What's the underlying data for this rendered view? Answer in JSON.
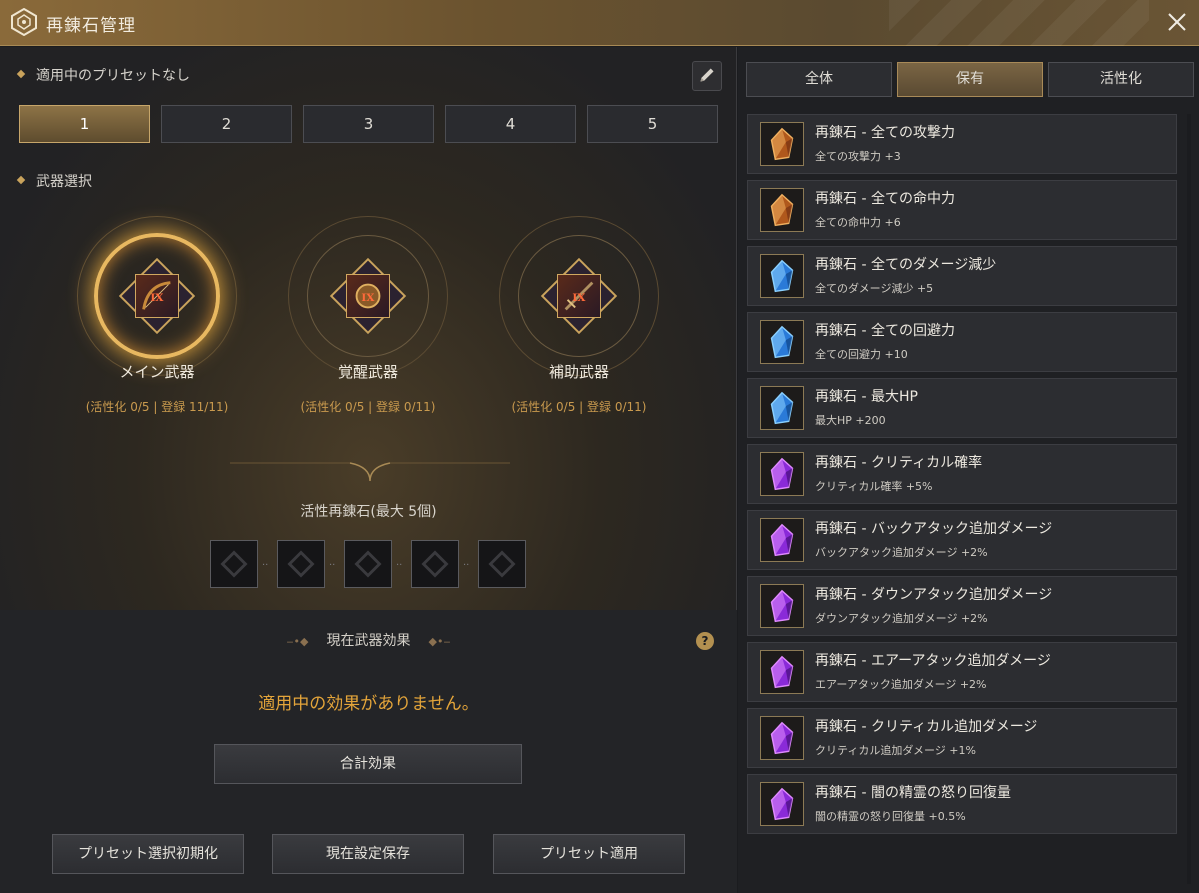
{
  "window": {
    "title": "再錬石管理",
    "logo_icon": "hexagon-logo-icon",
    "close_icon": "close-icon"
  },
  "preset": {
    "status_label": "適用中のプリセットなし",
    "tabs": [
      "1",
      "2",
      "3",
      "4",
      "5"
    ],
    "active_tab": "1"
  },
  "weapon_select": {
    "label": "武器選択",
    "weapons": [
      {
        "name": "メイン武器",
        "stat": "(活性化 0/5 | 登録 11/11)",
        "icon": "bow-icon",
        "grade": "IX",
        "selected": true
      },
      {
        "name": "覚醒武器",
        "stat": "(活性化 0/5 | 登録 0/11)",
        "icon": "orb-icon",
        "grade": "IX",
        "selected": false
      },
      {
        "name": "補助武器",
        "stat": "(活性化 0/5 | 登録 0/11)",
        "icon": "dagger-icon",
        "grade": "IX",
        "selected": false
      }
    ]
  },
  "active_stones": {
    "title": "活性再錬石(最大 5個)"
  },
  "effects": {
    "header": "現在武器効果",
    "empty_message": "適用中の効果がありません。",
    "total_button": "合計効果"
  },
  "footer": {
    "reset_button": "プリセット選択初期化",
    "save_button": "現在設定保存",
    "apply_button": "プリセット適用"
  },
  "filters": {
    "tabs": [
      "全体",
      "保有",
      "活性化"
    ],
    "active_tab": "保有"
  },
  "stones": [
    {
      "name": "再錬石 - 全ての攻撃力",
      "desc": "全ての攻撃力 +3",
      "gem": "orange"
    },
    {
      "name": "再錬石 - 全ての命中力",
      "desc": "全ての命中力 +6",
      "gem": "orange"
    },
    {
      "name": "再錬石 - 全てのダメージ減少",
      "desc": "全てのダメージ減少 +5",
      "gem": "blue"
    },
    {
      "name": "再錬石 - 全ての回避力",
      "desc": "全ての回避力 +10",
      "gem": "blue"
    },
    {
      "name": "再錬石 - 最大HP",
      "desc": "最大HP +200",
      "gem": "blue"
    },
    {
      "name": "再錬石 - クリティカル確率",
      "desc": "クリティカル確率 +5%",
      "gem": "purple"
    },
    {
      "name": "再錬石 - バックアタック追加ダメージ",
      "desc": "バックアタック追加ダメージ +2%",
      "gem": "purple"
    },
    {
      "name": "再錬石 - ダウンアタック追加ダメージ",
      "desc": "ダウンアタック追加ダメージ +2%",
      "gem": "purple"
    },
    {
      "name": "再錬石 - エアーアタック追加ダメージ",
      "desc": "エアーアタック追加ダメージ +2%",
      "gem": "purple"
    },
    {
      "name": "再錬石 - クリティカル追加ダメージ",
      "desc": "クリティカル追加ダメージ +1%",
      "gem": "purple"
    },
    {
      "name": "再錬石 - 闇の精霊の怒り回復量",
      "desc": "闇の精霊の怒り回復量 +0.5%",
      "gem": "purple"
    }
  ],
  "colors": {
    "accent_gold": "#c9a35c",
    "warning_text": "#e4a53a",
    "gem_orange": "#e89a4a",
    "gem_blue": "#4aa6e8",
    "gem_purple": "#b04ad8"
  }
}
